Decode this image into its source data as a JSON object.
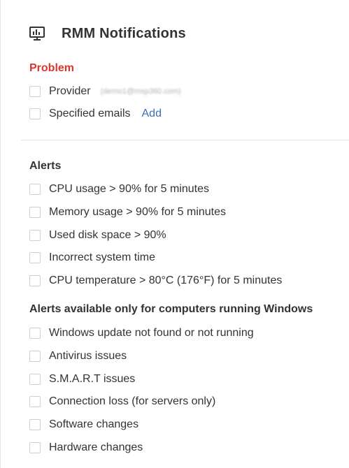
{
  "header": {
    "title": "RMM Notifications",
    "icon": "monitor-chart-icon"
  },
  "problem": {
    "title": "Problem",
    "title_color": "#d9372b",
    "items": [
      {
        "label": "Provider",
        "email": "(demo1@msp360.com)"
      },
      {
        "label": "Specified emails",
        "link": "Add"
      }
    ]
  },
  "alerts": {
    "title": "Alerts",
    "items": [
      "CPU usage > 90% for 5 minutes",
      "Memory usage > 90% for 5 minutes",
      "Used disk space > 90%",
      "Incorrect system time",
      "CPU temperature > 80°C (176°F) for 5 minutes"
    ]
  },
  "windows_alerts": {
    "title": "Alerts available only for computers running Windows",
    "items": [
      "Windows update not found or not running",
      "Antivirus issues",
      "S.M.A.R.T issues",
      "Connection loss (for servers only)",
      "Software changes",
      "Hardware changes"
    ]
  },
  "colors": {
    "link": "#3b6fb6",
    "text": "#333333",
    "checkbox_border": "#cfcfcf"
  }
}
